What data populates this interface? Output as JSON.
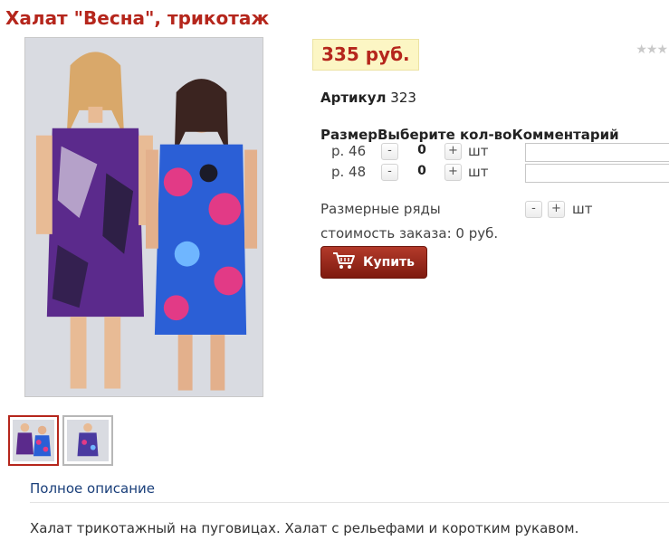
{
  "product": {
    "title": "Халат \"Весна\", трикотаж",
    "price": "335 руб.",
    "rating_stars": "★★★",
    "sku_label": "Артикул",
    "sku_value": "323"
  },
  "sizes": {
    "header": "РазмерВыберите кол-воКомментарий",
    "rows": [
      {
        "label": "р. 46",
        "minus": "-",
        "qty": "0",
        "plus": "+",
        "unit": "шт"
      },
      {
        "label": "р. 48",
        "minus": "-",
        "qty": "0",
        "plus": "+",
        "unit": "шт"
      }
    ],
    "size_rows_label": "Размерные ряды",
    "size_rows_minus": "-",
    "size_rows_plus": "+",
    "size_rows_unit": "шт"
  },
  "order": {
    "cost_text": "стоимость заказа: 0 руб.",
    "buy_label": "Купить"
  },
  "description": {
    "link": "Полное описание",
    "text": "Халат трикотажный на пуговицах. Халат с рельефами и коротким рукавом."
  },
  "icons": [
    "cart-icon",
    "star-icon"
  ],
  "colors": {
    "accent": "#b5261c",
    "price_bg": "#fcf6c4",
    "link": "#1a3f7a"
  }
}
